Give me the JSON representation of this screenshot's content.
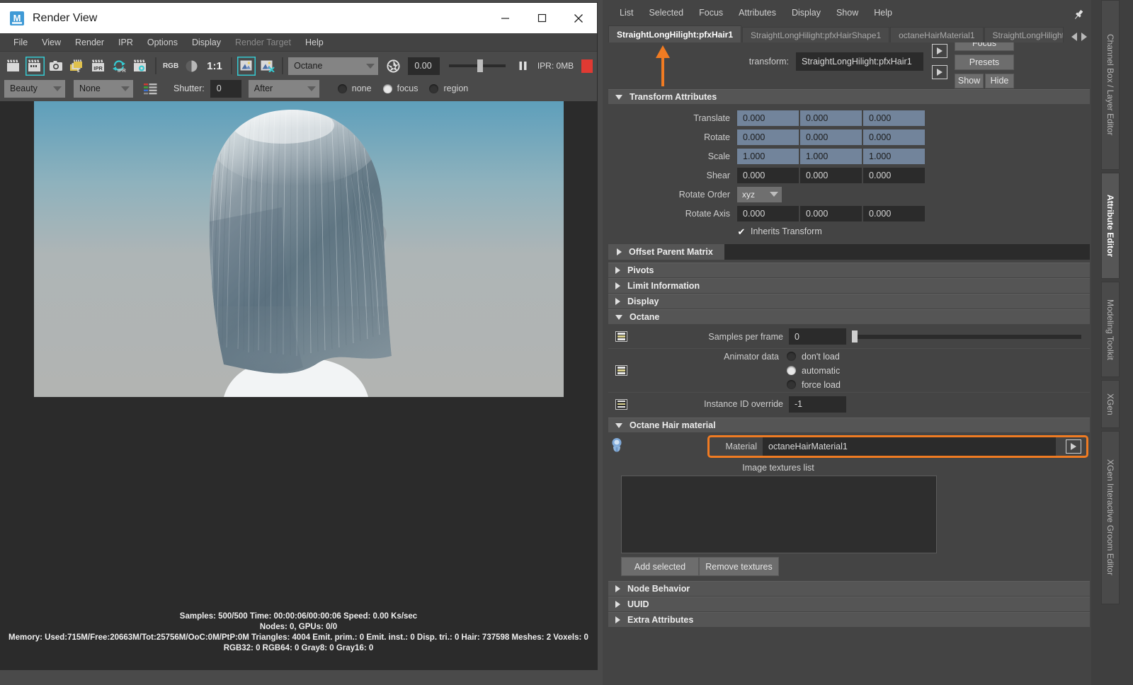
{
  "render_window": {
    "title": "Render View",
    "app_icon": "maya-icon",
    "window_buttons": {
      "minimize": "—",
      "maximize": "▢",
      "close": "✕"
    },
    "menus": [
      "File",
      "View",
      "Render",
      "IPR",
      "Options",
      "Display",
      "Render Target",
      "Help"
    ],
    "disabled_menus": [
      "Render Target"
    ],
    "toolbar": {
      "icons": [
        "render-clapper-icon",
        "render-region-clapper-icon",
        "snapshot-camera-icon",
        "render-sequence-icon",
        "ipr-clapper-icon",
        "ipr-refresh-icon",
        "render-settings-clapper-icon",
        "rgb-channel-icon",
        "alpha-channel-icon",
        "one-to-one-icon",
        "keep-image-icon",
        "remove-image-icon"
      ],
      "zoom_label": "1:1",
      "rgb_label": "RGB",
      "renderer": "Octane",
      "exposure_icon": "aperture-icon",
      "exposure_value": "0.00",
      "slider_value": 50,
      "pause_icon": "pause-icon",
      "ipr_memory": "IPR: 0MB",
      "stop_swatch_color": "#e03a33"
    },
    "toolbar2": {
      "pass": "Beauty",
      "aov": "None",
      "channels_icon": "color-channels-icon",
      "shutter_label": "Shutter:",
      "shutter_value": "0",
      "shutter_mode": "After",
      "region_modes": [
        "none",
        "focus",
        "region"
      ],
      "region_selected": "focus"
    },
    "status": {
      "line1": "Samples: 500/500 Time: 00:00:06/00:00:06 Speed: 0.00 Ks/sec",
      "line2": "Nodes: 0, GPUs: 0/0",
      "line3": "Memory: Used:715M/Free:20663M/Tot:25756M/OoC:0M/PtP:0M Triangles: 4004 Emit. prim.: 0 Emit. inst.: 0 Disp. tri.: 0 Hair: 737598 Meshes: 2 Voxels: 0",
      "line4": "RGB32: 0 RGB64: 0 Gray8: 0 Gray16: 0"
    }
  },
  "attribute_editor": {
    "menus": [
      "List",
      "Selected",
      "Focus",
      "Attributes",
      "Display",
      "Show",
      "Help"
    ],
    "pin_icon": "pin-icon",
    "tabs": [
      "StraightLongHilight:pfxHair1",
      "StraightLongHilight:pfxHairShape1",
      "octaneHairMaterial1",
      "StraightLongHilight"
    ],
    "active_tab_index": 0,
    "tab_scroll_left_icon": "chevron-left-icon",
    "tab_scroll_right_icon": "chevron-right-icon",
    "annotation_arrow": {
      "color": "#f07b22",
      "points_to": "active-tab"
    },
    "node": {
      "type_label": "transform:",
      "name": "StraightLongHilight:pfxHair1",
      "btn_focus": "Focus",
      "btn_presets": "Presets",
      "btn_show": "Show",
      "btn_hide": "Hide",
      "select_node_icon": "select-node-icon",
      "goto_output_icon": "goto-output-icon"
    },
    "transform_attributes": {
      "title": "Transform Attributes",
      "expanded": true,
      "rows": [
        {
          "label": "Translate",
          "values": [
            "0.000",
            "0.000",
            "0.000"
          ],
          "style": "connected"
        },
        {
          "label": "Rotate",
          "values": [
            "0.000",
            "0.000",
            "0.000"
          ],
          "style": "connected"
        },
        {
          "label": "Scale",
          "values": [
            "1.000",
            "1.000",
            "1.000"
          ],
          "style": "connected"
        },
        {
          "label": "Shear",
          "values": [
            "0.000",
            "0.000",
            "0.000"
          ],
          "style": "plain"
        }
      ],
      "rotate_order": {
        "label": "Rotate Order",
        "value": "xyz"
      },
      "rotate_axis": {
        "label": "Rotate Axis",
        "values": [
          "0.000",
          "0.000",
          "0.000"
        ],
        "style": "plain"
      },
      "inherits_transform": {
        "label": "Inherits Transform",
        "checked": true
      }
    },
    "offset_parent_matrix": {
      "label": "Offset Parent Matrix",
      "expanded": false,
      "value": ""
    },
    "collapsed_sections": [
      {
        "label": "Pivots"
      },
      {
        "label": "Limit Information"
      },
      {
        "label": "Display"
      }
    ],
    "octane": {
      "title": "Octane",
      "expanded": true,
      "samples_per_frame": {
        "label": "Samples per frame",
        "value": "0",
        "slider_pct": 0
      },
      "animator_data": {
        "label": "Animator data",
        "options": [
          "don't load",
          "automatic",
          "force load"
        ],
        "selected": "automatic"
      },
      "instance_id_override": {
        "label": "Instance ID override",
        "value": "-1"
      }
    },
    "octane_hair_material": {
      "title": "Octane Hair material",
      "expanded": true,
      "material_icon": "material-swatch-icon",
      "material_label": "Material",
      "material_value": "octaneHairMaterial1",
      "goto_material_icon": "goto-node-icon",
      "highlight_color": "#f07b22",
      "image_textures_label": "Image textures list",
      "image_textures_items": [],
      "btn_add_selected": "Add selected",
      "btn_remove_textures": "Remove textures"
    },
    "bottom_sections": [
      {
        "label": "Node Behavior"
      },
      {
        "label": "UUID"
      },
      {
        "label": "Extra Attributes"
      }
    ]
  },
  "right_rail": {
    "tabs": [
      "Channel Box / Layer Editor",
      "Attribute Editor",
      "Modeling Toolkit",
      "XGen",
      "XGen Interactive Groom Editor"
    ],
    "active": "Attribute Editor"
  }
}
